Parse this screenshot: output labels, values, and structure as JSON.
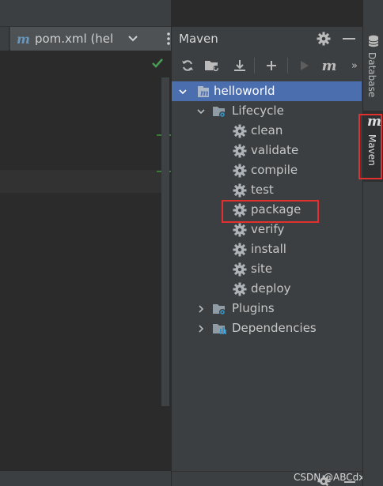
{
  "editor": {
    "tab_label": "pom.xml (hell"
  },
  "maven_panel": {
    "title": "Maven",
    "toolbar": {
      "icons": [
        "refresh-icon",
        "add-folder-icon",
        "download-icon",
        "plus-icon",
        "run-icon",
        "maven-goal-icon",
        "expand-more-icon"
      ],
      "expand_label": "»",
      "goal_label": "m"
    },
    "tree": {
      "root": "helloworld",
      "lifecycle": "Lifecycle",
      "goals": [
        "clean",
        "validate",
        "compile",
        "test",
        "package",
        "verify",
        "install",
        "site",
        "deploy"
      ],
      "plugins": "Plugins",
      "dependencies": "Dependencies"
    },
    "highlighted_goal": "package"
  },
  "right_strip": {
    "database_label": "Database",
    "maven_label": "Maven",
    "maven_icon_text": "m"
  },
  "watermark": "CSDN @ABCdxy~",
  "colors": {
    "selection": "#4b6eaf",
    "highlight_box": "#e0312f",
    "maven_blue": "#6897bb",
    "check_green": "#499c54"
  }
}
